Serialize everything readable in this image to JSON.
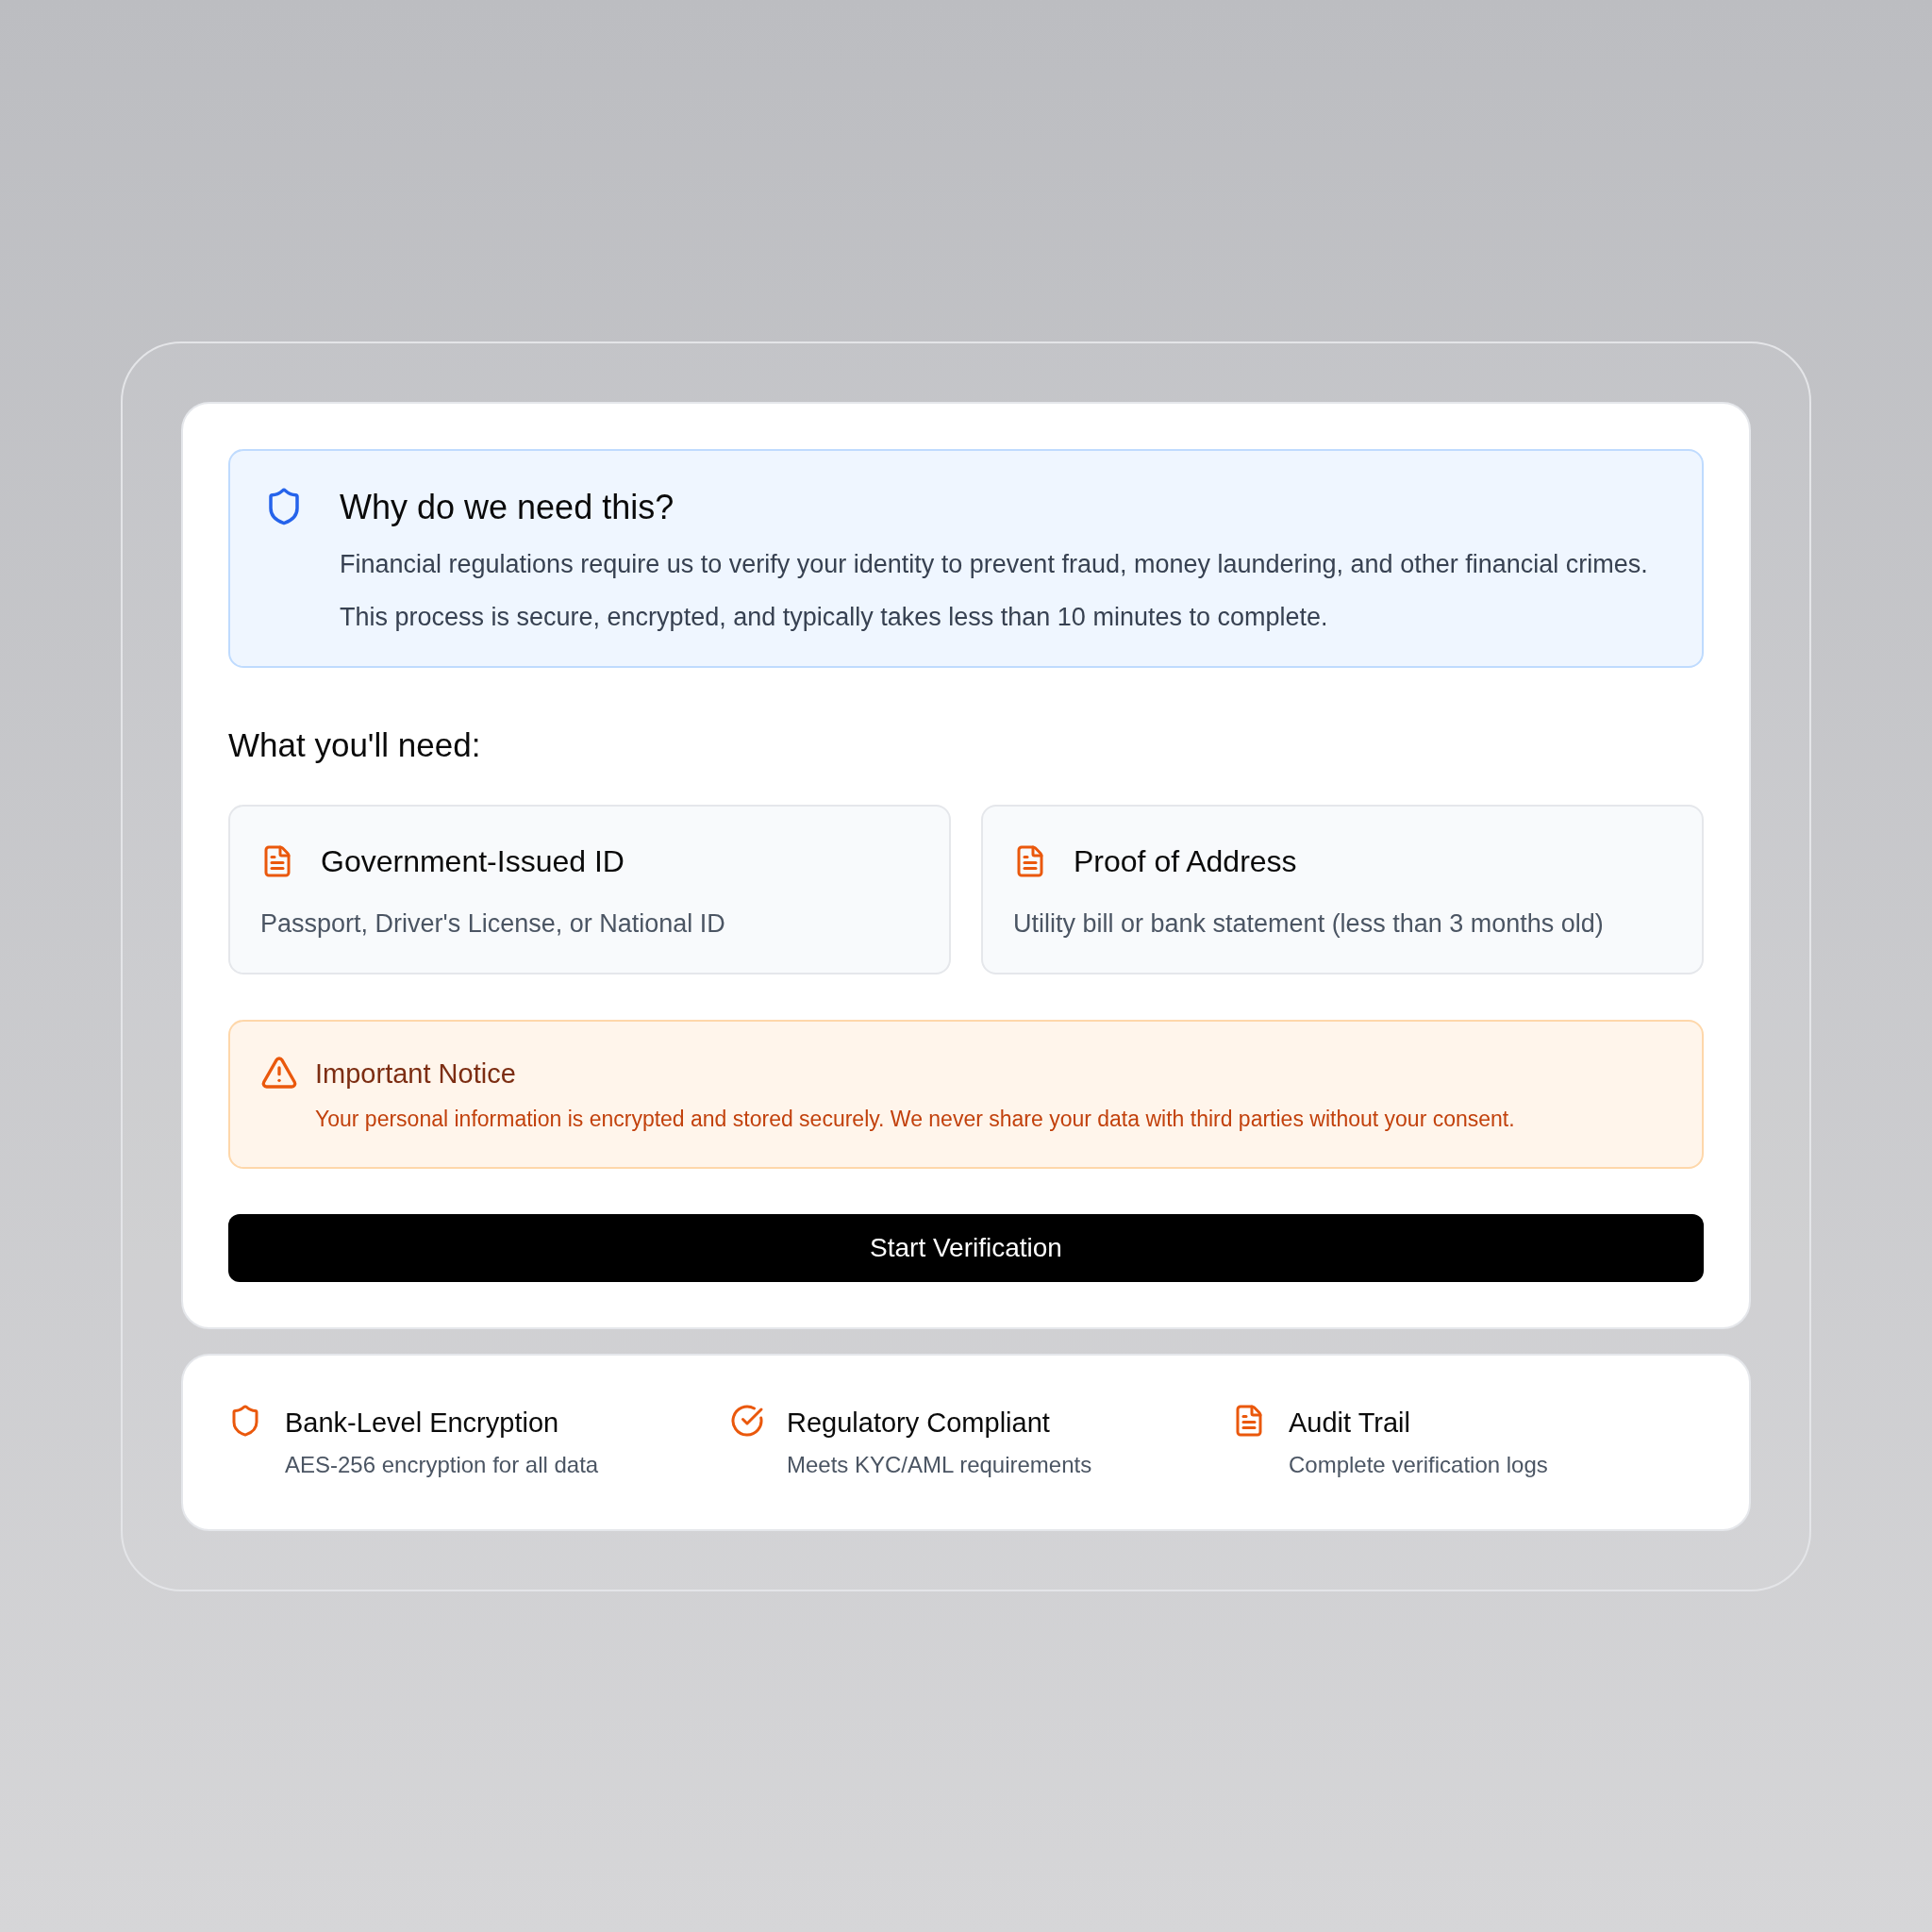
{
  "info": {
    "title": "Why do we need this?",
    "paragraphs": [
      "Financial regulations require us to verify your identity to prevent fraud, money laundering, and other financial crimes.",
      "This process is secure, encrypted, and typically takes less than 10 minutes to complete."
    ]
  },
  "requirements": {
    "heading": "What you'll need:",
    "items": [
      {
        "title": "Government-Issued ID",
        "description": "Passport, Driver's License, or National ID"
      },
      {
        "title": "Proof of Address",
        "description": "Utility bill or bank statement (less than 3 months old)"
      }
    ]
  },
  "notice": {
    "title": "Important Notice",
    "text": "Your personal information is encrypted and stored securely. We never share your data with third parties without your consent."
  },
  "button": "Start Verification",
  "features": [
    {
      "kind": "shield",
      "title": "Bank-Level Encryption",
      "description": "AES-256 encryption for all data"
    },
    {
      "kind": "check",
      "title": "Regulatory Compliant",
      "description": "Meets KYC/AML requirements"
    },
    {
      "kind": "document",
      "title": "Audit Trail",
      "description": "Complete verification logs"
    }
  ]
}
